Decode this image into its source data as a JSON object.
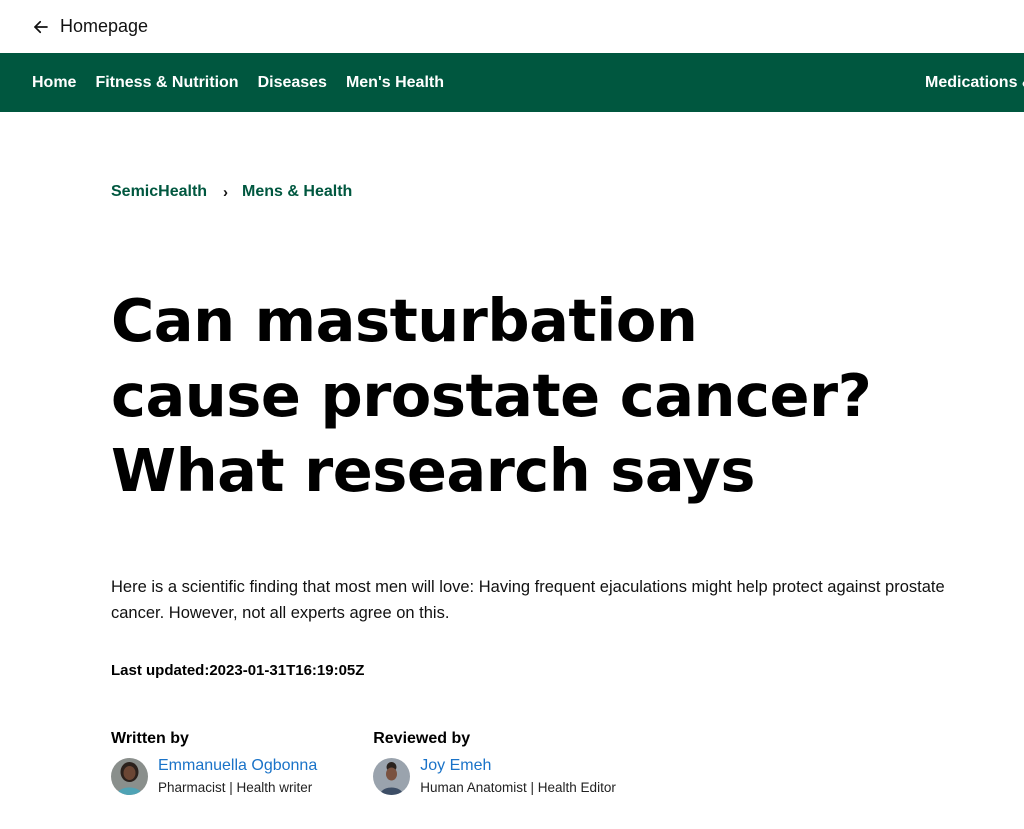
{
  "topbar": {
    "back_label": "Homepage"
  },
  "nav": {
    "items": [
      "Home",
      "Fitness & Nutrition",
      "Diseases",
      "Men's Health"
    ],
    "right_item": "Medications &"
  },
  "breadcrumb": {
    "site": "SemicHealth",
    "separator": "›",
    "section": "Mens & Health"
  },
  "article": {
    "title": "Can masturbation cause prostate cancer? What research says",
    "summary": "Here is a scientific finding that most men will love: Having frequent ejaculations might help protect against prostate cancer. However, not all experts agree on this.",
    "last_updated": "Last updated:2023-01-31T16:19:05Z"
  },
  "authors": {
    "written_by_label": "Written by",
    "writer_name": "Emmanuella Ogbonna",
    "writer_desc": "Pharmacist | Health writer",
    "reviewed_by_label": "Reviewed by",
    "reviewer_name": "Joy Emeh",
    "reviewer_desc": "Human Anatomist | Health Editor"
  },
  "colors": {
    "brand_green": "#00573f",
    "link_blue": "#1a73c8"
  }
}
